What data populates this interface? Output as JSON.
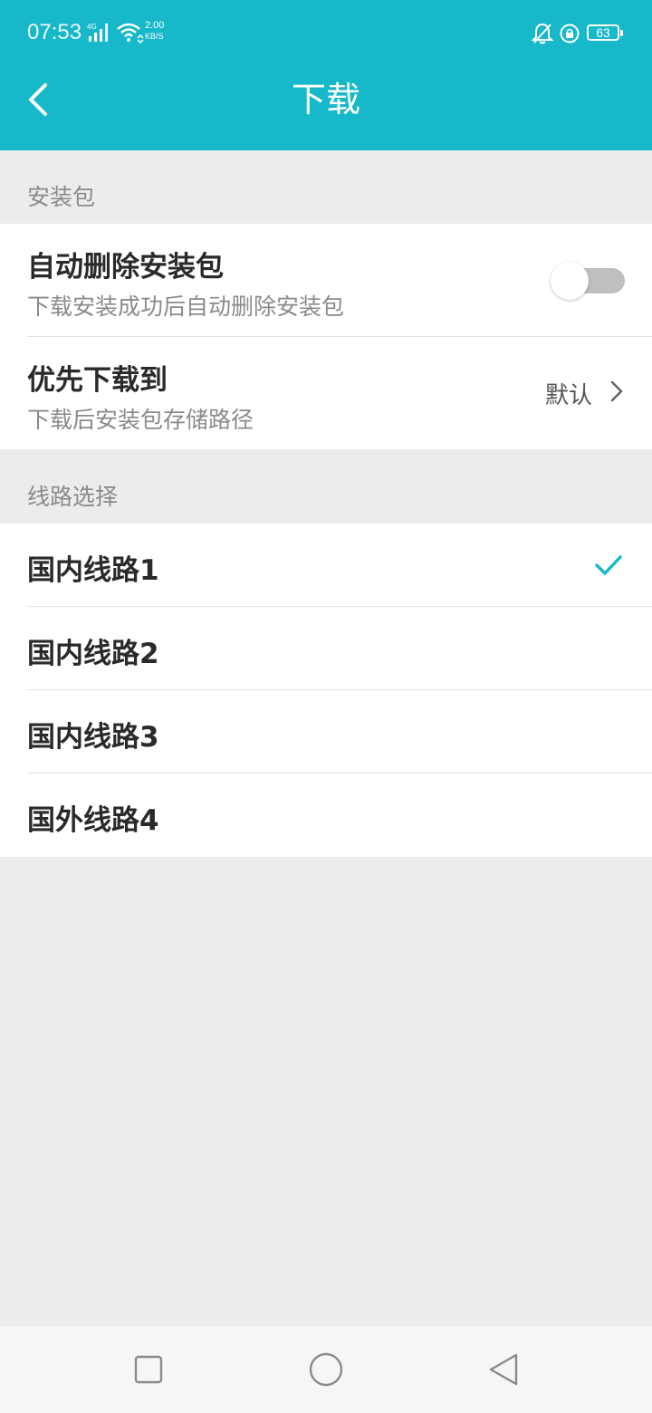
{
  "status_bar": {
    "time": "07:53",
    "network": "4G",
    "speed_value": "2.00",
    "speed_unit": "KB/S",
    "battery": "63",
    "icons": [
      "signal-icon",
      "wifi-icon",
      "bell-mute-icon",
      "rotation-lock-icon",
      "battery-icon"
    ]
  },
  "header": {
    "title": "下载",
    "back_icon": "chevron-left-icon",
    "background": "#17b8c9"
  },
  "sections": [
    {
      "header": "安装包",
      "items": [
        {
          "title": "自动删除安装包",
          "subtitle": "下载安装成功后自动删除安装包",
          "control": "toggle",
          "enabled": false
        },
        {
          "title": "优先下载到",
          "subtitle": "下载后安装包存储路径",
          "value": "默认",
          "control": "chevron-right-icon"
        }
      ]
    },
    {
      "header": "线路选择",
      "items": [
        {
          "title": "国内线路1",
          "selected": true
        },
        {
          "title": "国内线路2",
          "selected": false
        },
        {
          "title": "国内线路3",
          "selected": false
        },
        {
          "title": "国外线路4",
          "selected": false
        }
      ]
    }
  ],
  "accent_color": "#17b8c9",
  "nav_bar": {
    "buttons": [
      "recents-square-icon",
      "home-circle-icon",
      "back-triangle-icon"
    ]
  }
}
